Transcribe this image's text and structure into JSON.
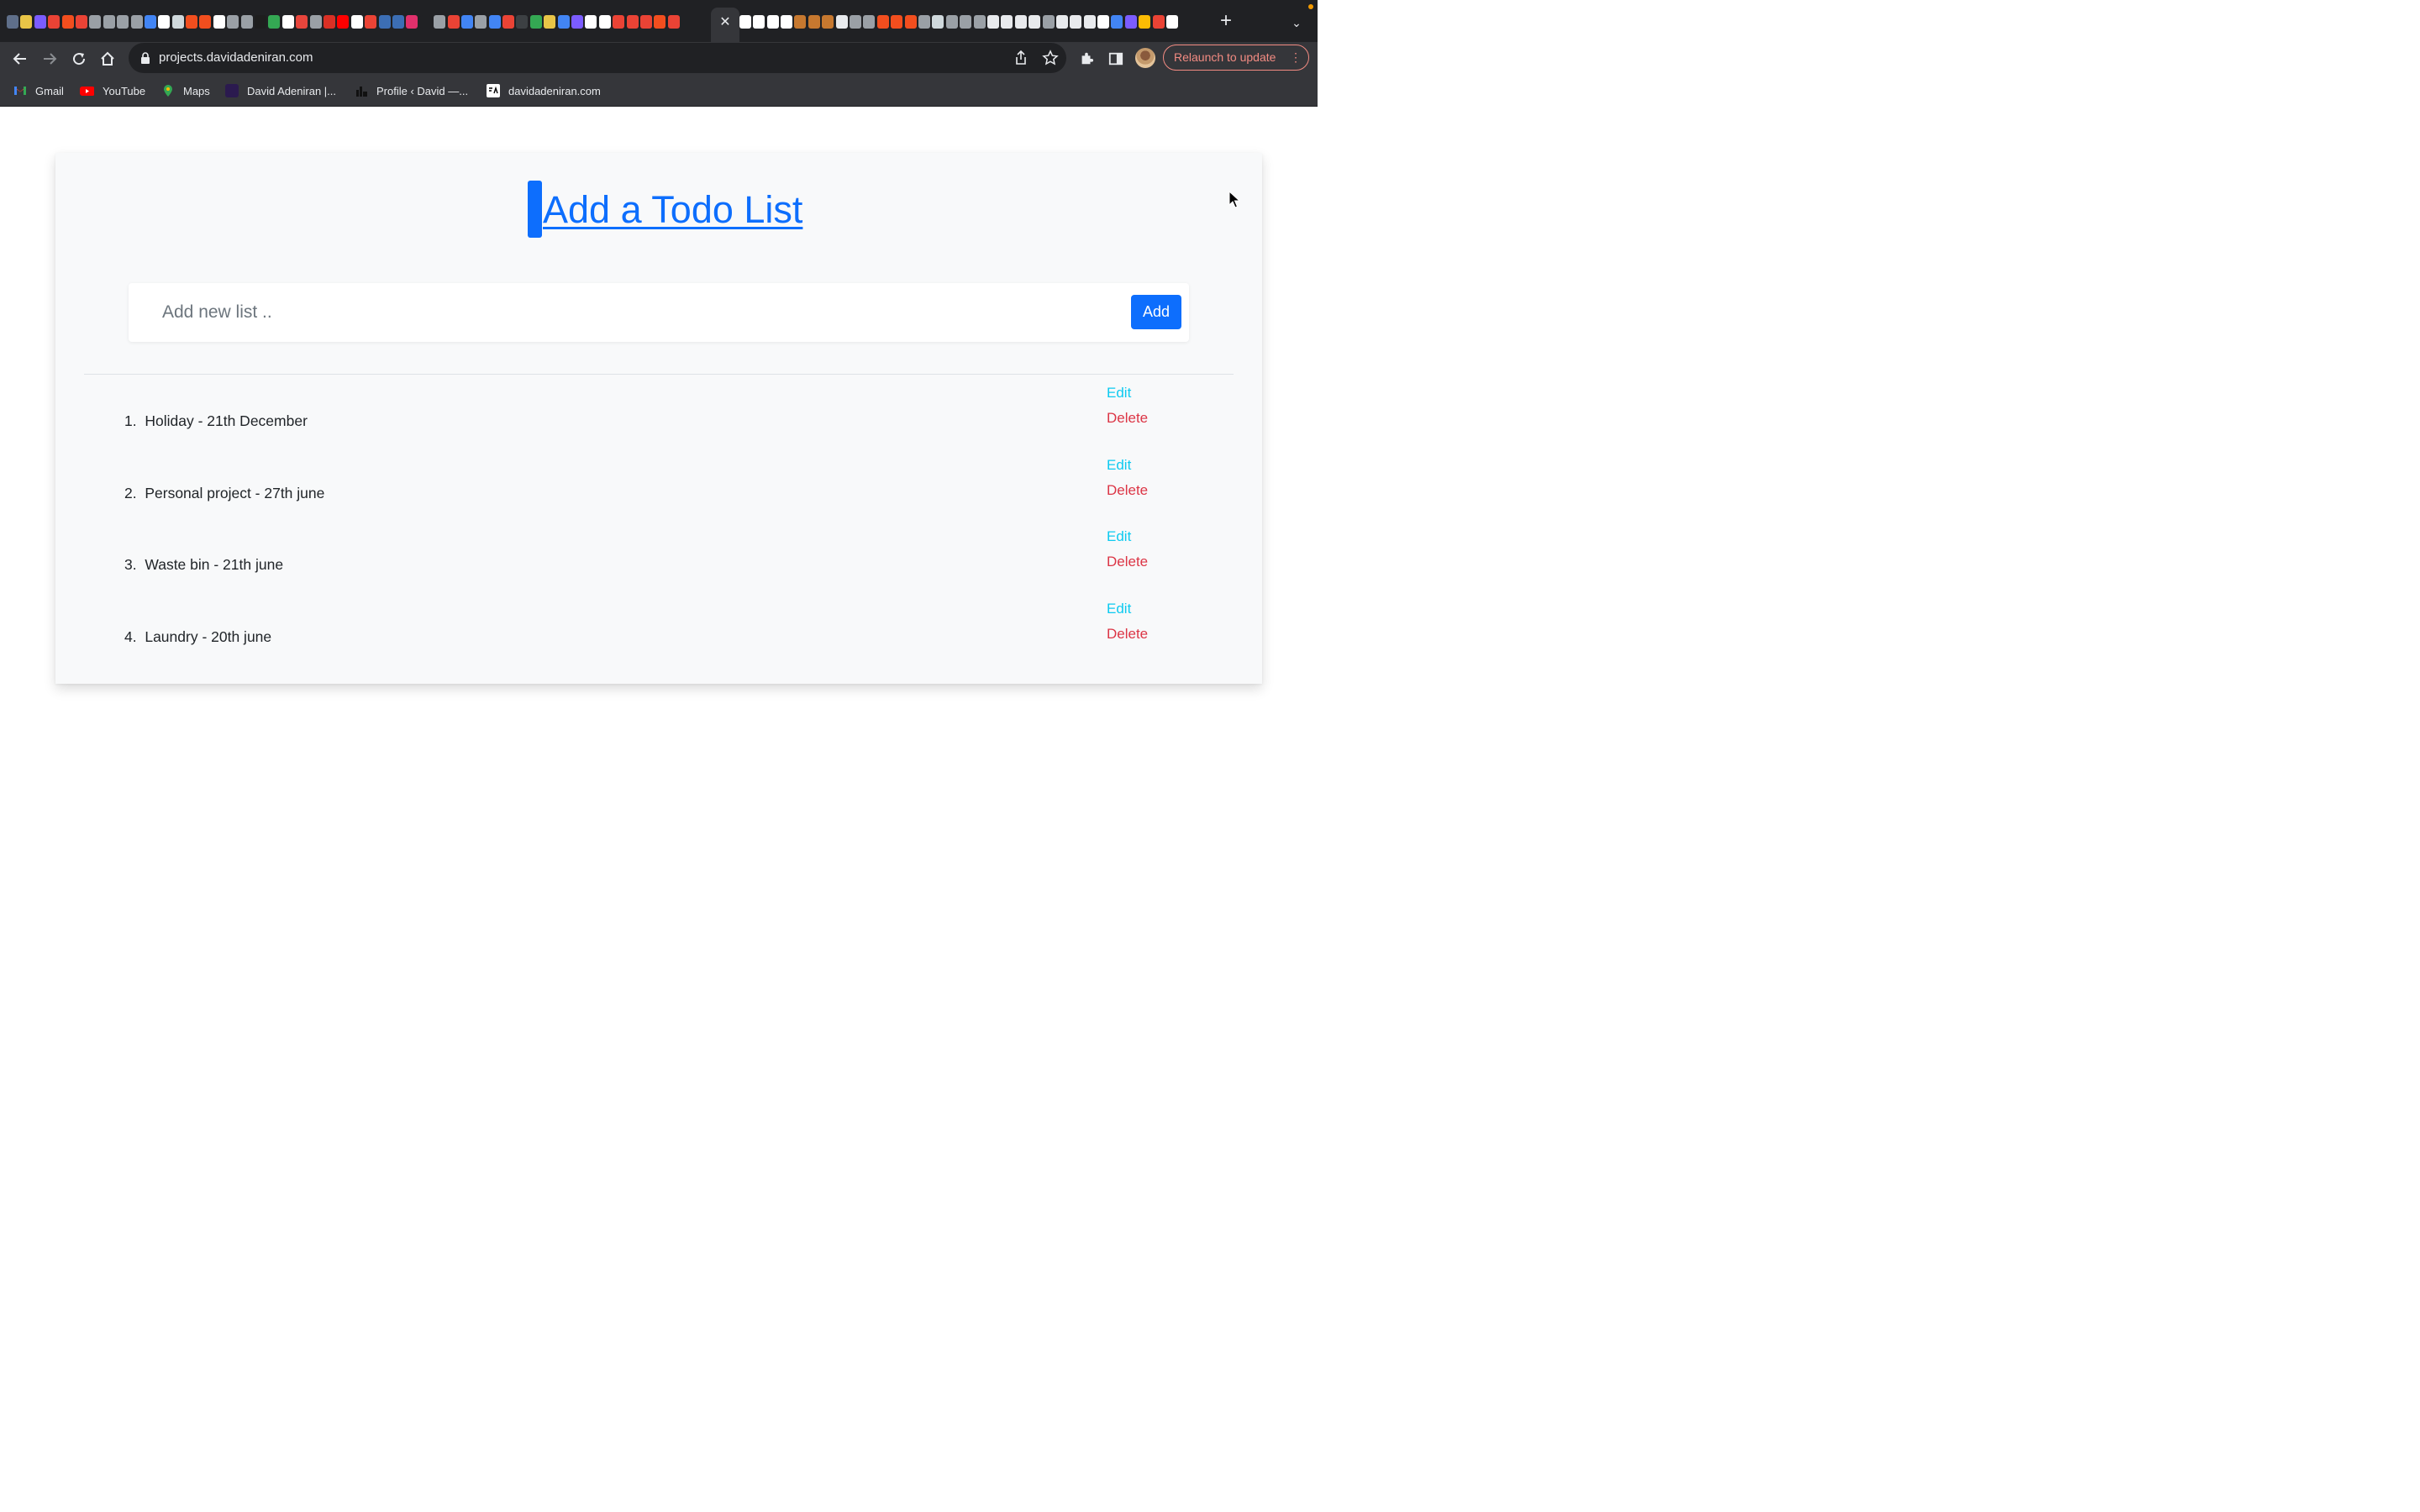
{
  "browser": {
    "url": "projects.davidadeniran.com",
    "relaunch_label": "Relaunch to update",
    "tab_close_glyph": "✕",
    "new_tab_glyph": "+",
    "tab_search_glyph": "⌄",
    "relaunch_menu_glyph": "⋮",
    "tab_favicon_colors": [
      "#5f6f8a",
      "#e8c547",
      "#7b5cff",
      "#ea4335",
      "#f24e1e",
      "#ea4335",
      "#9aa0a6",
      "#9aa0a6",
      "#9aa0a6",
      "#9aa0a6",
      "#4285f4",
      "#ffffff",
      "#cfd8dc",
      "#f24e1e",
      "#f24e1e",
      "#ffffff",
      "#9aa0a6",
      "#9aa0a6",
      "#1e1e1e",
      "#34a853",
      "#ffffff",
      "#e8453c",
      "#9aa0a6",
      "#d93025",
      "#ff0000",
      "#ffffff",
      "#ea4335",
      "#3c6eb4",
      "#3c6eb4",
      "#e1306c",
      "#202124",
      "#9aa0a6",
      "#ea4335",
      "#4285f4",
      "#9aa0a6",
      "#4285f4",
      "#ea4335",
      "#3c4043",
      "#34a853",
      "#e8c547",
      "#4285f4",
      "#7b5cff",
      "#ffffff",
      "#ffffff",
      "#ea4335",
      "#ea4335",
      "#ea4335",
      "#f24e1e",
      "#ea4335"
    ],
    "tab_favicon_colors_right": [
      "#cfd8dc",
      "#ffffff",
      "#ffffff",
      "#ffffff",
      "#ffffff",
      "#ffffff",
      "#c6782f",
      "#c6782f",
      "#c6782f",
      "#e8eaed",
      "#9aa0a6",
      "#9aa0a6",
      "#f24e1e",
      "#f24e1e",
      "#f24e1e",
      "#9aa0a6",
      "#cfd8dc",
      "#9aa0a6",
      "#9aa0a6",
      "#9aa0a6",
      "#e8eaed",
      "#e8eaed",
      "#e8eaed",
      "#e8eaed",
      "#9aa0a6",
      "#e8eaed",
      "#e8eaed",
      "#e8eaed",
      "#ffffff",
      "#4285f4",
      "#7b5cff",
      "#fbbc04",
      "#ea4335",
      "#ffffff"
    ]
  },
  "bookmarks": [
    {
      "label": "Gmail",
      "icon": "gmail-icon",
      "color": "#ea4335"
    },
    {
      "label": "YouTube",
      "icon": "youtube-icon",
      "color": "#ff0000"
    },
    {
      "label": "Maps",
      "icon": "maps-icon",
      "color": "#34a853"
    },
    {
      "label": "David Adeniran |...",
      "icon": "site-icon",
      "color": "#2b1a4f"
    },
    {
      "label": "Profile ‹ David —...",
      "icon": "profile-icon",
      "color": "#1e1e1e"
    },
    {
      "label": "davidadeniran.com",
      "icon": "da-icon",
      "color": "#ffffff"
    }
  ],
  "page": {
    "title": "Add a Todo List",
    "input_placeholder": "Add new list ..",
    "input_value": "",
    "add_label": "Add",
    "todos": [
      {
        "number": "1.",
        "text": "Holiday - 21th December",
        "edit": "Edit",
        "delete": "Delete"
      },
      {
        "number": "2.",
        "text": "Personal project - 27th june",
        "edit": "Edit",
        "delete": "Delete"
      },
      {
        "number": "3.",
        "text": "Waste bin - 21th june",
        "edit": "Edit",
        "delete": "Delete"
      },
      {
        "number": "4.",
        "text": "Laundry - 20th june",
        "edit": "Edit",
        "delete": "Delete"
      }
    ]
  },
  "colors": {
    "primary": "#0d6efd",
    "info": "#0dcaf0",
    "danger": "#dc3545",
    "chrome_dark": "#202124",
    "chrome_toolbar": "#35363a"
  }
}
